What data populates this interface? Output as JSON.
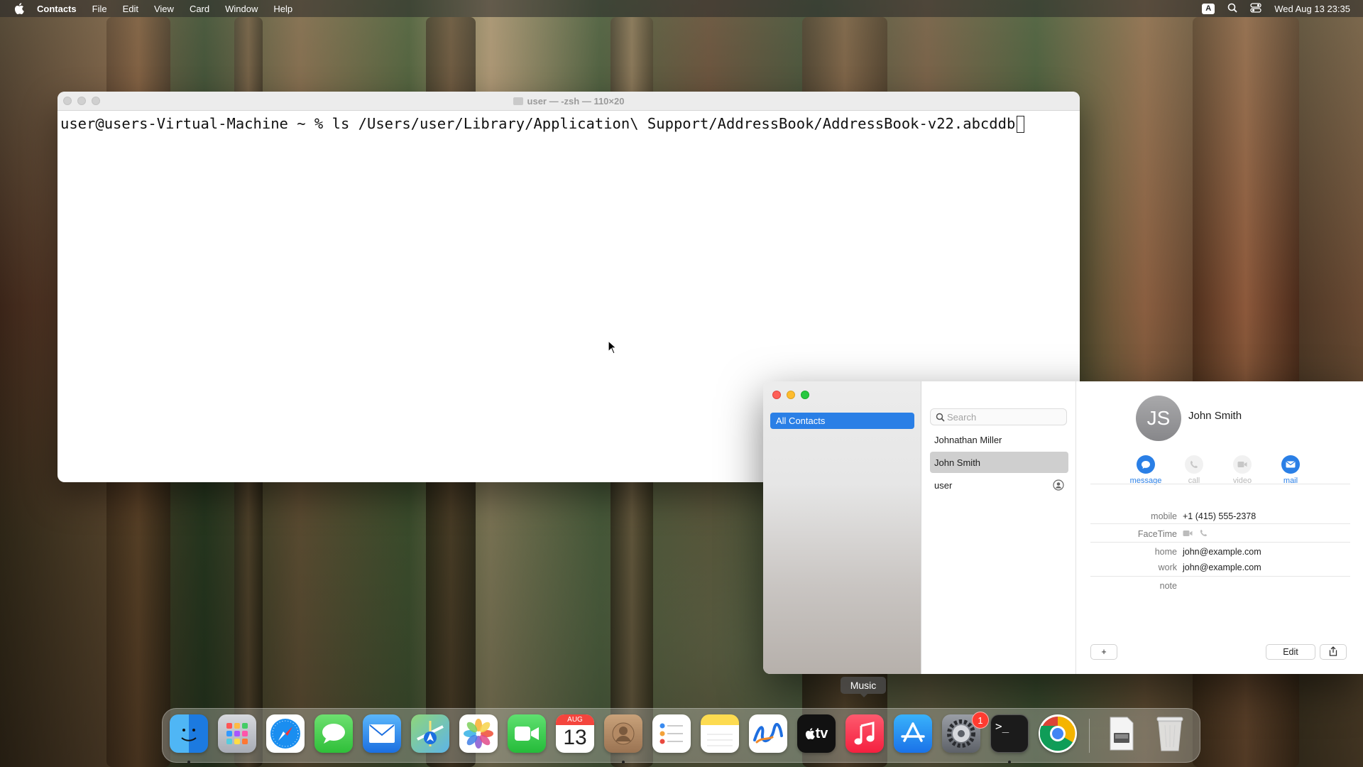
{
  "menubar": {
    "app_name": "Contacts",
    "menus": [
      "File",
      "Edit",
      "View",
      "Card",
      "Window",
      "Help"
    ],
    "input_source": "A",
    "datetime": "Wed Aug 13  23:35"
  },
  "terminal": {
    "title": "user — -zsh — 110×20",
    "command_line": "user@users-Virtual-Machine ~ % ls /Users/user/Library/Application\\ Support/AddressBook/AddressBook-v22.abcddb"
  },
  "contacts": {
    "sidebar": {
      "group": "All Contacts"
    },
    "search": {
      "placeholder": "Search"
    },
    "list": [
      "Johnathan Miller",
      "John Smith",
      "user"
    ],
    "selected_index": 1,
    "card": {
      "initials": "JS",
      "name": "John Smith",
      "actions": [
        "message",
        "call",
        "video",
        "mail"
      ],
      "fields": [
        {
          "label": "mobile",
          "value": "+1 (415) 555-2378"
        },
        {
          "label": "FaceTime",
          "value": ""
        },
        {
          "label": "home",
          "value": "john@example.com"
        },
        {
          "label": "work",
          "value": "john@example.com"
        },
        {
          "label": "note",
          "value": ""
        }
      ],
      "add_label": "+",
      "edit_label": "Edit"
    }
  },
  "dock": {
    "tooltip": "Music",
    "calendar_month": "AUG",
    "calendar_day": "13",
    "tv_label": "tv",
    "settings_badge": "1",
    "terminal_glyph": ">_",
    "apps": [
      "Finder",
      "Launchpad",
      "Safari",
      "Messages",
      "Mail",
      "Maps",
      "Photos",
      "FaceTime",
      "Calendar",
      "Contacts",
      "Reminders",
      "Notes",
      "Freeform",
      "TV",
      "Music",
      "App Store",
      "System Settings",
      "Terminal",
      "Chrome",
      "Preview",
      "Trash"
    ]
  },
  "colors": {
    "accent": "#2a7fe6",
    "music": "#fa2d48",
    "badge": "#ff3b30"
  }
}
